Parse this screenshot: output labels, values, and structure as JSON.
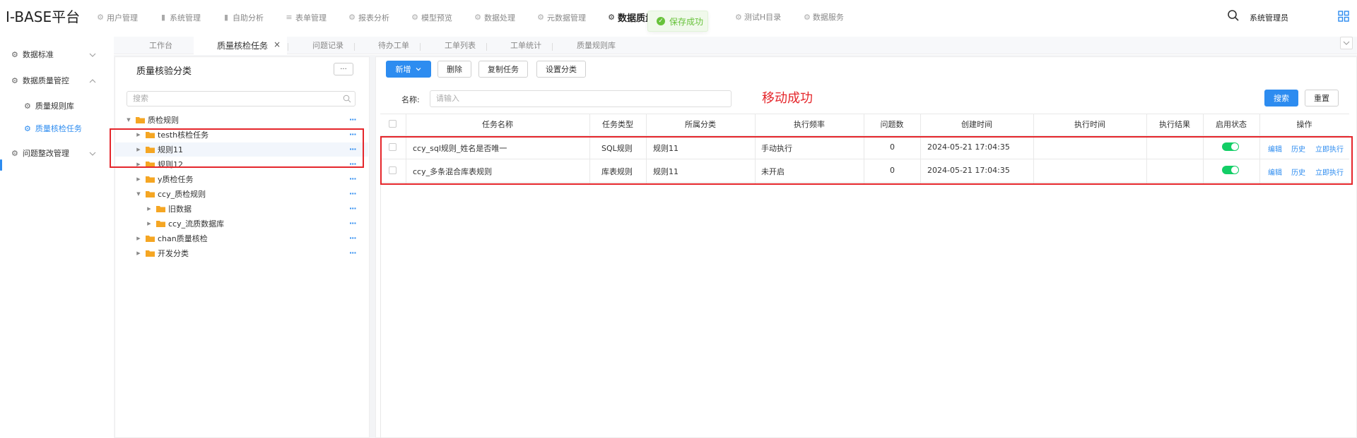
{
  "app": {
    "title": "I-BASE平台"
  },
  "top_nav": [
    {
      "label": "用户管理",
      "icon": "gear-icon"
    },
    {
      "label": "系统管理",
      "icon": "bar-chart-icon"
    },
    {
      "label": "自助分析",
      "icon": "bar-chart-icon"
    },
    {
      "label": "表单管理",
      "icon": "list-icon"
    },
    {
      "label": "报表分析",
      "icon": "gear-icon"
    },
    {
      "label": "模型预览",
      "icon": "gear-icon"
    },
    {
      "label": "数据处理",
      "icon": "gear-icon"
    },
    {
      "label": "元数据管理",
      "icon": "gear-icon"
    },
    {
      "label": "数据质量",
      "icon": "gear-icon"
    }
  ],
  "top_nav_right": [
    {
      "label": "测试H目录",
      "icon": "gear-icon"
    },
    {
      "label": "数据服务",
      "icon": "gear-icon"
    }
  ],
  "toast": {
    "text": "保存成功",
    "color": "#67c23a"
  },
  "header": {
    "user": "系统管理员"
  },
  "sidebar": {
    "items": [
      {
        "label": "数据标准"
      },
      {
        "label": "数据质量管控"
      },
      {
        "label": "质量规则库"
      },
      {
        "label": "质量核检任务"
      },
      {
        "label": "问题整改管理"
      }
    ]
  },
  "tabs": [
    {
      "label": "工作台"
    },
    {
      "label": "质量核检任务",
      "active": true
    },
    {
      "label": "问题记录"
    },
    {
      "label": "待办工单"
    },
    {
      "label": "工单列表"
    },
    {
      "label": "工单统计"
    },
    {
      "label": "质量规则库"
    }
  ],
  "tree": {
    "title": "质量核验分类",
    "more_label": "···",
    "search_placeholder": "搜索",
    "nodes": [
      {
        "label": "质检规则",
        "expanded": true
      },
      {
        "label": "testh核检任务"
      },
      {
        "label": "规则11"
      },
      {
        "label": "规则12"
      },
      {
        "label": "y质检任务"
      },
      {
        "label": "ccy_质检规则",
        "expanded": true
      },
      {
        "label": "旧数据"
      },
      {
        "label": "ccy_流质数据库"
      },
      {
        "label": "chan质量核检"
      },
      {
        "label": "开发分类"
      }
    ],
    "row_menu": "···"
  },
  "toolbar": {
    "add": "新增",
    "delete": "删除",
    "copy": "复制任务",
    "set_category": "设置分类"
  },
  "filter": {
    "name_label": "名称:",
    "name_placeholder": "请输入",
    "search": "搜索",
    "reset": "重置"
  },
  "annotation": {
    "text": "移动成功"
  },
  "table": {
    "columns": [
      "任务名称",
      "任务类型",
      "所属分类",
      "执行频率",
      "问题数",
      "创建时间",
      "执行时间",
      "执行结果",
      "启用状态",
      "操作"
    ],
    "rows": [
      {
        "name": "ccy_sql规则_姓名是否唯一",
        "type": "SQL规则",
        "category": "规则11",
        "frequency": "手动执行",
        "issues": "0",
        "created": "2024-05-21 17:04:35",
        "exec_time": "",
        "result": "",
        "enabled": true,
        "ops": [
          "编辑",
          "历史",
          "立即执行"
        ]
      },
      {
        "name": "ccy_多条混合库表规则",
        "type": "库表规则",
        "category": "规则11",
        "frequency": "未开启",
        "issues": "0",
        "created": "2024-05-21 17:04:35",
        "exec_time": "",
        "result": "",
        "enabled": true,
        "ops": [
          "编辑",
          "历史",
          "立即执行"
        ]
      }
    ]
  },
  "colors": {
    "primary": "#2d8cf0",
    "highlight_box": "#e5262b",
    "switch_on": "#13ce66"
  }
}
